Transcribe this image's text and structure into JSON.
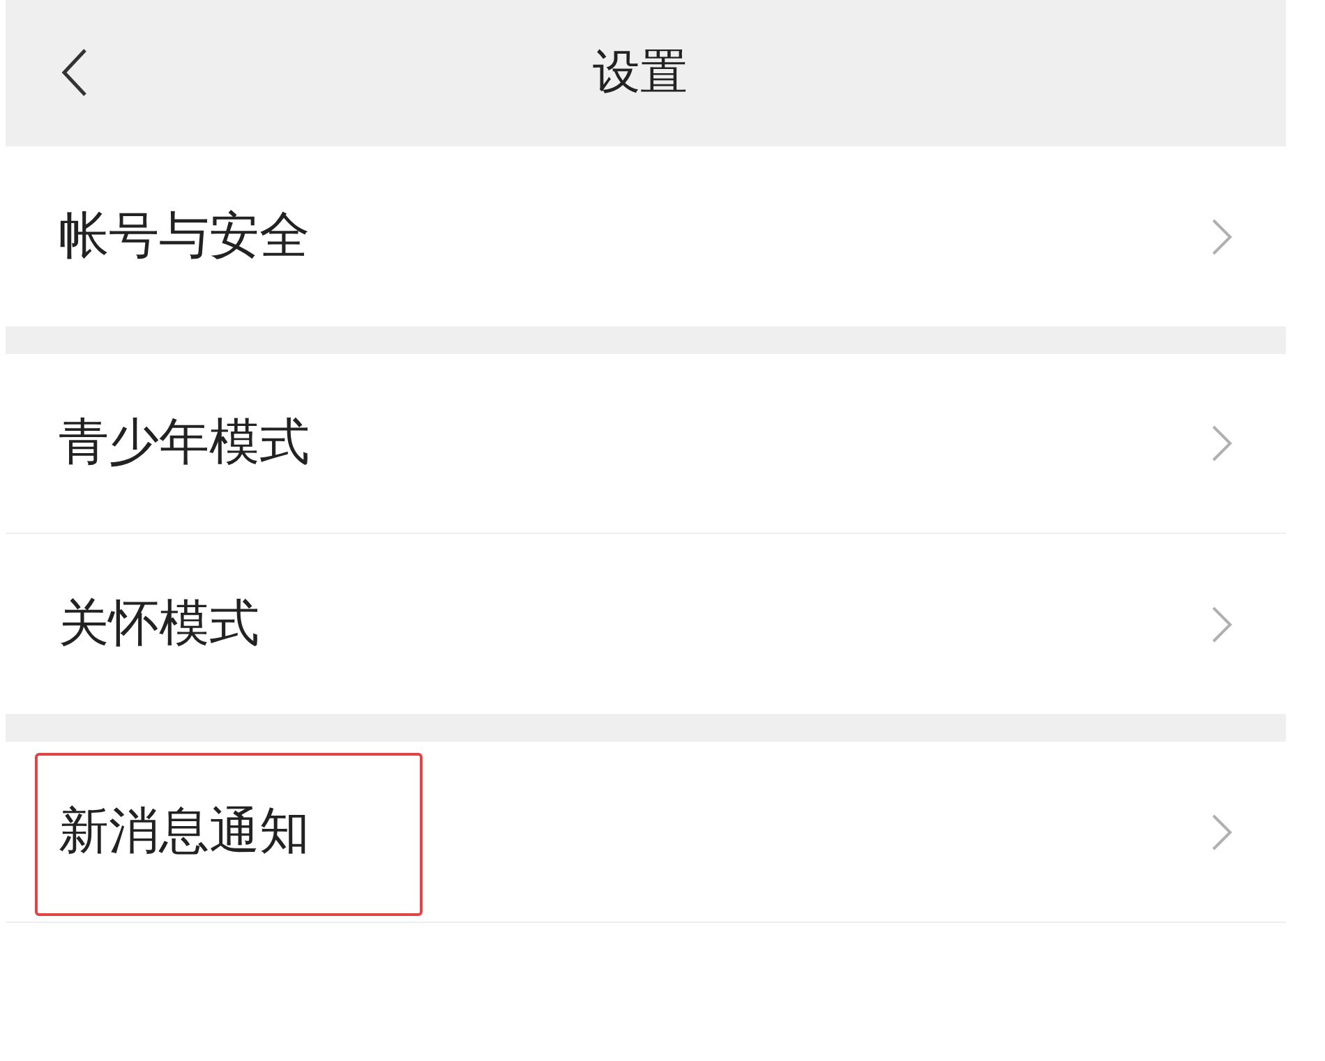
{
  "header": {
    "title": "设置"
  },
  "sections": [
    {
      "items": [
        {
          "label": "帐号与安全",
          "highlighted": false
        }
      ]
    },
    {
      "items": [
        {
          "label": "青少年模式",
          "highlighted": false
        },
        {
          "label": "关怀模式",
          "highlighted": false
        }
      ]
    },
    {
      "items": [
        {
          "label": "新消息通知",
          "highlighted": true
        }
      ]
    }
  ]
}
